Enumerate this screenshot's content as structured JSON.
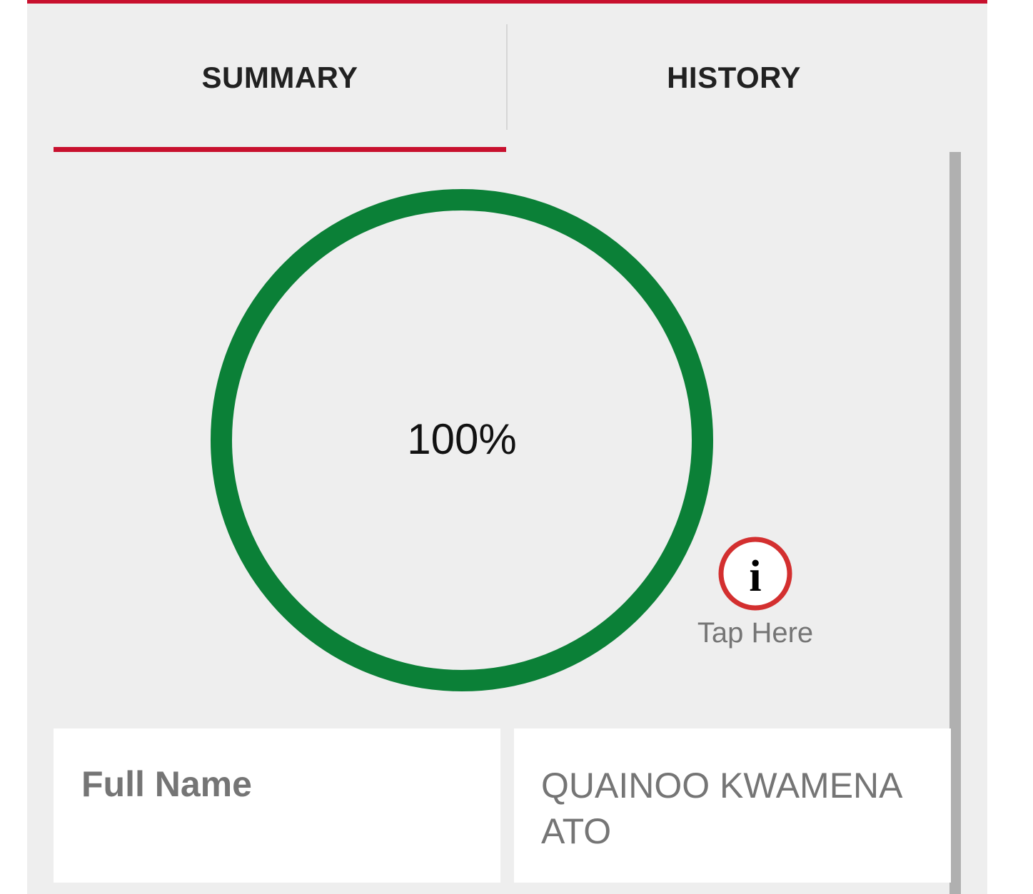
{
  "colors": {
    "accent": "#c8102e",
    "progress_ring": "#0b8037",
    "background": "#eeeeee"
  },
  "tabs": [
    {
      "label": "SUMMARY",
      "selected": true
    },
    {
      "label": "HISTORY",
      "selected": false
    }
  ],
  "progress": {
    "value_text": "100%",
    "fraction": 1.0
  },
  "info": {
    "icon": "info-icon",
    "glyph": "i",
    "label": "Tap Here"
  },
  "details": {
    "full_name_label": "Full Name",
    "full_name_value": "QUAINOO KWAMENA ATO"
  }
}
